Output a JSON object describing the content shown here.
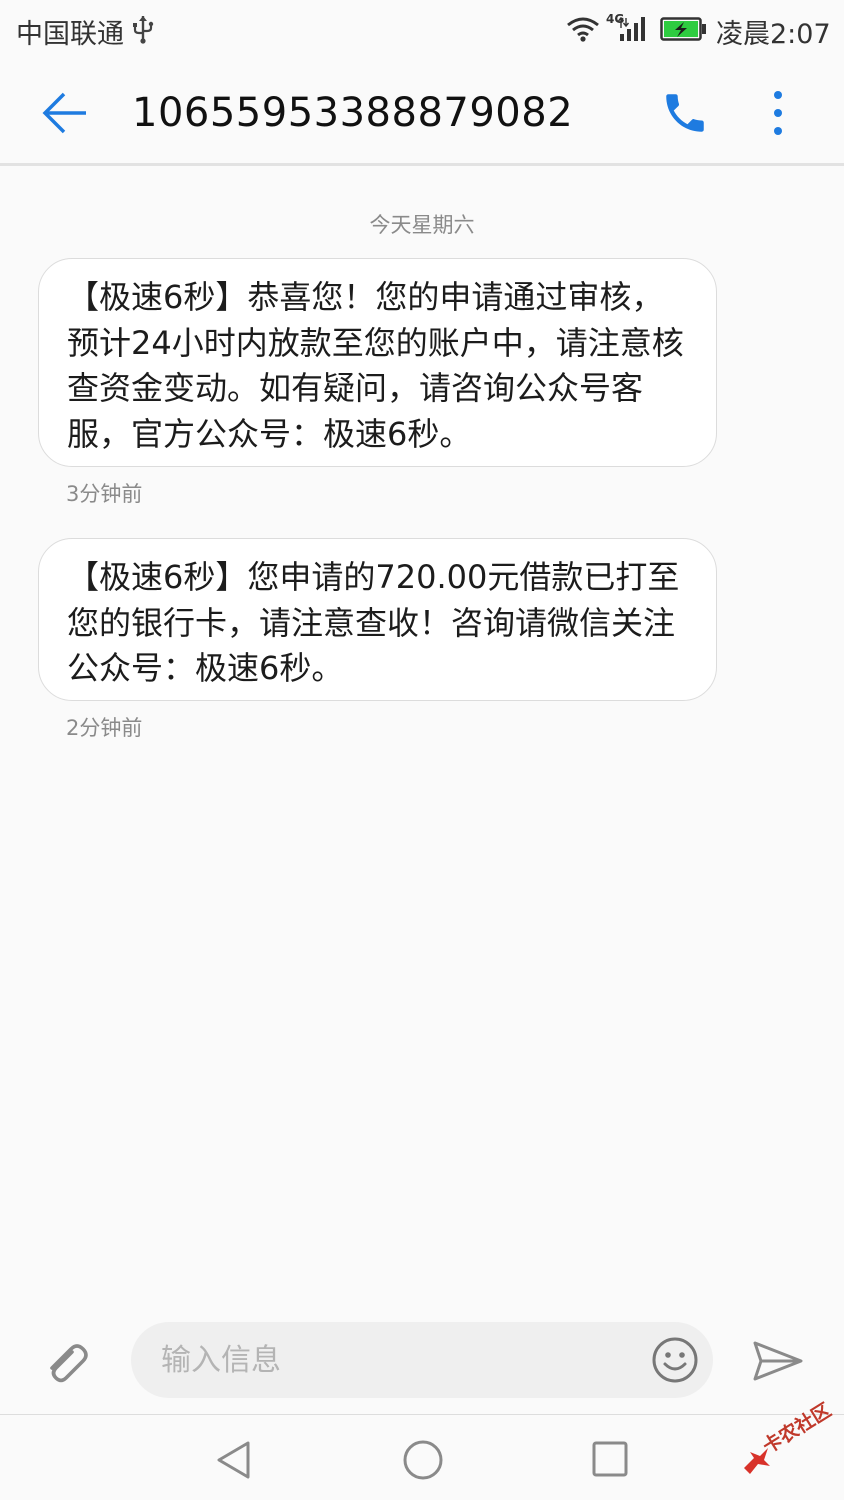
{
  "status_bar": {
    "carrier": "中国联通",
    "network_type": "4G",
    "time": "凌晨2:07",
    "icons": [
      "usb-icon",
      "wifi-icon",
      "signal-icon",
      "battery-charging-icon"
    ]
  },
  "header": {
    "title": "10655953388879082",
    "icons": [
      "back-arrow-icon",
      "phone-call-icon",
      "more-vertical-icon"
    ]
  },
  "conversation": {
    "date_divider": "今天星期六",
    "messages": [
      {
        "text": "【极速6秒】恭喜您！您的申请通过审核，预计24小时内放款至您的账户中，请注意核查资金变动。如有疑问，请咨询公众号客服，官方公众号：极速6秒。",
        "time": "3分钟前"
      },
      {
        "text": "【极速6秒】您申请的720.00元借款已打至您的银行卡，请注意查收！咨询请微信关注公众号：极速6秒。",
        "time": "2分钟前"
      }
    ]
  },
  "compose": {
    "placeholder": "输入信息",
    "value": "",
    "icons": [
      "paperclip-icon",
      "emoji-icon",
      "send-icon"
    ]
  },
  "nav_bar": {
    "icons": [
      "nav-back-icon",
      "nav-home-icon",
      "nav-recents-icon"
    ]
  },
  "watermark": {
    "text": "卡农社区"
  },
  "colors": {
    "accent": "#1e7be0",
    "background": "#fafafa",
    "bubble": "#ffffff",
    "secondary_text": "#8a8a8a",
    "battery_fill": "#2ecc40"
  }
}
